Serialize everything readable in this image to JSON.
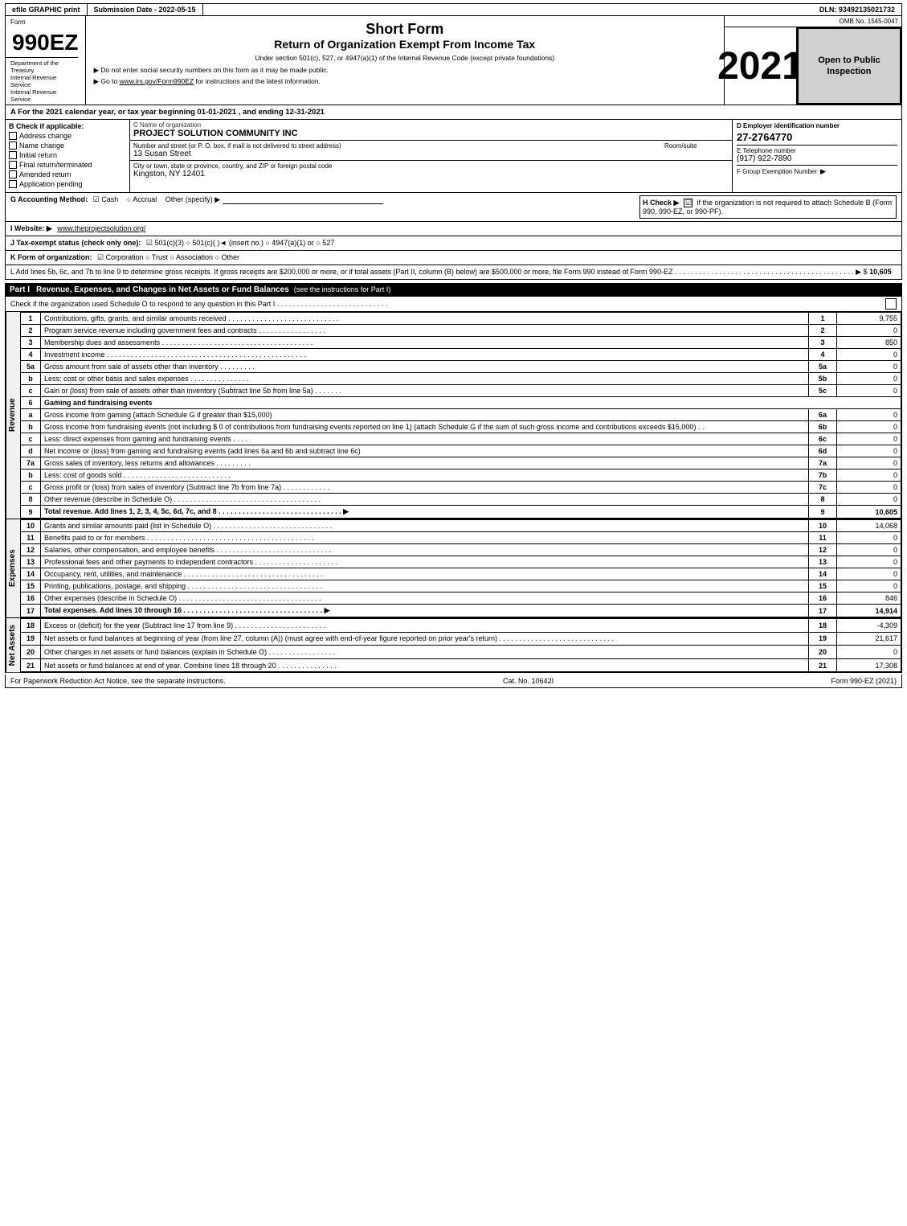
{
  "header": {
    "efile": "efile GRAPHIC print",
    "submission_label": "Submission Date - 2022-05-15",
    "dln": "DLN: 93492135021732",
    "omb": "OMB No. 1545-0047",
    "form_title": "Short Form",
    "form_subtitle": "Return of Organization Exempt From Income Tax",
    "form_year": "2021",
    "under_section": "Under section 501(c), 527, or 4947(a)(1) of the Internal Revenue Code (except private foundations)",
    "ssn_notice": "▶ Do not enter social security numbers on this form as it may be made public.",
    "irs_link": "▶ Go to www.irs.gov/Form990EZ for instructions and the latest information.",
    "open_to_public": "Open to Public Inspection",
    "form_number": "990EZ",
    "dept1": "Department of the Treasury",
    "dept2": "Internal Revenue Service"
  },
  "section_a": {
    "label": "A  For the 2021 calendar year, or tax year beginning 01-01-2021 , and ending 12-31-2021"
  },
  "section_b": {
    "label": "B  Check if applicable:",
    "items": [
      {
        "id": "address-change",
        "label": "Address change",
        "checked": false
      },
      {
        "id": "name-change",
        "label": "Name change",
        "checked": false
      },
      {
        "id": "initial-return",
        "label": "Initial return",
        "checked": false
      },
      {
        "id": "final-return",
        "label": "Final return/terminated",
        "checked": false
      },
      {
        "id": "amended-return",
        "label": "Amended return",
        "checked": false
      },
      {
        "id": "application-pending",
        "label": "Application pending",
        "checked": false
      }
    ]
  },
  "org": {
    "name_label": "C Name of organization",
    "name_value": "PROJECT SOLUTION COMMUNITY INC",
    "address_label": "Number and street (or P. O. box, if mail is not delivered to street address)",
    "address_value": "13 Susan Street",
    "room_label": "Room/suite",
    "city_label": "City or town, state or province, country, and ZIP or foreign postal code",
    "city_value": "Kingston, NY  12401",
    "ein_label": "D Employer identification number",
    "ein_value": "27-2764770",
    "phone_label": "E Telephone number",
    "phone_value": "(917) 922-7890",
    "group_exemption_label": "F Group Exemption Number",
    "group_exemption_arrow": "▶"
  },
  "section_g": {
    "label": "G Accounting Method:",
    "cash": "☑ Cash",
    "accrual": "○ Accrual",
    "other": "Other (specify) ▶",
    "h_label": "H  Check ▶",
    "h_checked": true,
    "h_text": "if the organization is not required to attach Schedule B (Form 990, 990-EZ, or 990-PF)."
  },
  "website": {
    "label": "I Website: ▶",
    "url": "www.theprojectsolution.org/"
  },
  "tax_exempt_status": {
    "label": "J Tax-exempt status (check only one):",
    "options": "☑ 501(c)(3)  ○ 501(c)(   )◄ (insert no.)  ○ 4947(a)(1) or  ○ 527"
  },
  "form_of_org": {
    "label": "K Form of organization:",
    "options": "☑ Corporation   ○ Trust   ○ Association   ○ Other"
  },
  "line_l": {
    "text": "L Add lines 5b, 6c, and 7b to line 9 to determine gross receipts. If gross receipts are $200,000 or more, or if total assets (Part II, column (B) below) are $500,000 or more, file Form 990 instead of Form 990-EZ . . . . . . . . . . . . . . . . . . . . . . . . . . . . . . . . . . . . . . . . . . . . . ▶ $",
    "amount": "10,605"
  },
  "part1": {
    "label": "Part I",
    "title": "Revenue, Expenses, and Changes in Net Assets or Fund Balances",
    "instructions": "(see the instructions for Part I)",
    "check_text": "Check if the organization used Schedule O to respond to any question in this Part I . . . . . . . . . . . . . . . . . . . . . . . . . . . .",
    "lines": [
      {
        "num": "1",
        "desc": "Contributions, gifts, grants, and similar amounts received . . . . . . . . . . . . . . . . . . . . . . . . . . . .",
        "line_ref": "1",
        "amount": "9,755"
      },
      {
        "num": "2",
        "desc": "Program service revenue including government fees and contracts . . . . . . . . . . . . . . . . .",
        "line_ref": "2",
        "amount": "0"
      },
      {
        "num": "3",
        "desc": "Membership dues and assessments . . . . . . . . . . . . . . . . . . . . . . . . . . . . . . . . . . . . . .",
        "line_ref": "3",
        "amount": "850"
      },
      {
        "num": "4",
        "desc": "Investment income . . . . . . . . . . . . . . . . . . . . . . . . . . . . . . . . . . . . . . . . . . . . . . . . . .",
        "line_ref": "4",
        "amount": "0"
      },
      {
        "num": "5a",
        "desc": "Gross amount from sale of assets other than inventory . . . . . . . . .",
        "sub_ref": "5a",
        "sub_amount": "0"
      },
      {
        "num": "5b",
        "desc": "Less: cost or other basis and sales expenses . . . . . . . . . . . . . . .",
        "sub_ref": "5b",
        "sub_amount": "0"
      },
      {
        "num": "5c",
        "desc": "Gain or (loss) from sale of assets other than inventory (Subtract line 5b from line 5a) . . . . . . .",
        "line_ref": "5c",
        "amount": "0"
      },
      {
        "num": "6",
        "desc": "Gaming and fundraising events",
        "is_header": true
      },
      {
        "num": "6a",
        "desc": "Gross income from gaming (attach Schedule G if greater than $15,000)",
        "sub_ref": "6a",
        "sub_amount": "0"
      },
      {
        "num": "6b",
        "desc": "Gross income from fundraising events (not including $ 0 of contributions from fundraising events reported on line 1) (attach Schedule G if the sum of such gross income and contributions exceeds $15,000) . .",
        "sub_ref": "6b",
        "sub_amount": "0"
      },
      {
        "num": "6c",
        "desc": "Less: direct expenses from gaming and fundraising events . . . .",
        "sub_ref": "6c",
        "sub_amount": "0"
      },
      {
        "num": "6d",
        "desc": "Net income or (loss) from gaming and fundraising events (add lines 6a and 6b and subtract line 6c)",
        "line_ref": "6d",
        "amount": "0"
      },
      {
        "num": "7a",
        "desc": "Gross sales of inventory, less returns and allowances . . . . . . . . .",
        "sub_ref": "7a",
        "sub_amount": "0"
      },
      {
        "num": "7b",
        "desc": "Less: cost of goods sold . . . . . . . . . . . . . . . . . . . . . . . . . . .",
        "sub_ref": "7b",
        "sub_amount": "0"
      },
      {
        "num": "7c",
        "desc": "Gross profit or (loss) from sales of inventory (Subtract line 7b from line 7a) . . . . . . . . . . . .",
        "line_ref": "7c",
        "amount": "0"
      },
      {
        "num": "8",
        "desc": "Other revenue (describe in Schedule O) . . . . . . . . . . . . . . . . . . . . . . . . . . . . . . . . . . . . .",
        "line_ref": "8",
        "amount": "0"
      },
      {
        "num": "9",
        "desc": "Total revenue. Add lines 1, 2, 3, 4, 5c, 6d, 7c, and 8 . . . . . . . . . . . . . . . . . . . . . . . . . . . . . . . ▶",
        "line_ref": "9",
        "amount": "10,605",
        "bold": true
      }
    ]
  },
  "expenses": {
    "lines": [
      {
        "num": "10",
        "desc": "Grants and similar amounts paid (list in Schedule O) . . . . . . . . . . . . . . . . . . . . . . . . . . . . . .",
        "line_ref": "10",
        "amount": "14,068"
      },
      {
        "num": "11",
        "desc": "Benefits paid to or for members . . . . . . . . . . . . . . . . . . . . . . . . . . . . . . . . . . . . . . . . . .",
        "line_ref": "11",
        "amount": "0"
      },
      {
        "num": "12",
        "desc": "Salaries, other compensation, and employee benefits . . . . . . . . . . . . . . . . . . . . . . . . . . . . .",
        "line_ref": "12",
        "amount": "0"
      },
      {
        "num": "13",
        "desc": "Professional fees and other payments to independent contractors . . . . . . . . . . . . . . . . . . . . .",
        "line_ref": "13",
        "amount": "0"
      },
      {
        "num": "14",
        "desc": "Occupancy, rent, utilities, and maintenance . . . . . . . . . . . . . . . . . . . . . . . . . . . . . . . . . . .",
        "line_ref": "14",
        "amount": "0"
      },
      {
        "num": "15",
        "desc": "Printing, publications, postage, and shipping . . . . . . . . . . . . . . . . . . . . . . . . . . . . . . . . . .",
        "line_ref": "15",
        "amount": "0"
      },
      {
        "num": "16",
        "desc": "Other expenses (describe in Schedule O) . . . . . . . . . . . . . . . . . . . . . . . . . . . . . . . . . . . .",
        "line_ref": "16",
        "amount": "846"
      },
      {
        "num": "17",
        "desc": "Total expenses. Add lines 10 through 16 . . . . . . . . . . . . . . . . . . . . . . . . . . . . . . . . . . . ▶",
        "line_ref": "17",
        "amount": "14,914",
        "bold": true
      }
    ]
  },
  "net_assets": {
    "lines": [
      {
        "num": "18",
        "desc": "Excess or (deficit) for the year (Subtract line 17 from line 9) . . . . . . . . . . . . . . . . . . . . . . .",
        "line_ref": "18",
        "amount": "-4,309"
      },
      {
        "num": "19",
        "desc": "Net assets or fund balances at beginning of year (from line 27, column (A)) (must agree with end-of-year figure reported on prior year's return) . . . . . . . . . . . . . . . . . . . . . . . . . . . . .",
        "line_ref": "19",
        "amount": "21,617"
      },
      {
        "num": "20",
        "desc": "Other changes in net assets or fund balances (explain in Schedule O) . . . . . . . . . . . . . . . . .",
        "line_ref": "20",
        "amount": "0"
      },
      {
        "num": "21",
        "desc": "Net assets or fund balances at end of year. Combine lines 18 through 20 . . . . . . . . . . . . . . .",
        "line_ref": "21",
        "amount": "17,308"
      }
    ]
  },
  "footer": {
    "paperwork": "For Paperwork Reduction Act Notice, see the separate instructions.",
    "cat_no": "Cat. No. 10642I",
    "form_ref": "Form 990-EZ (2021)"
  }
}
